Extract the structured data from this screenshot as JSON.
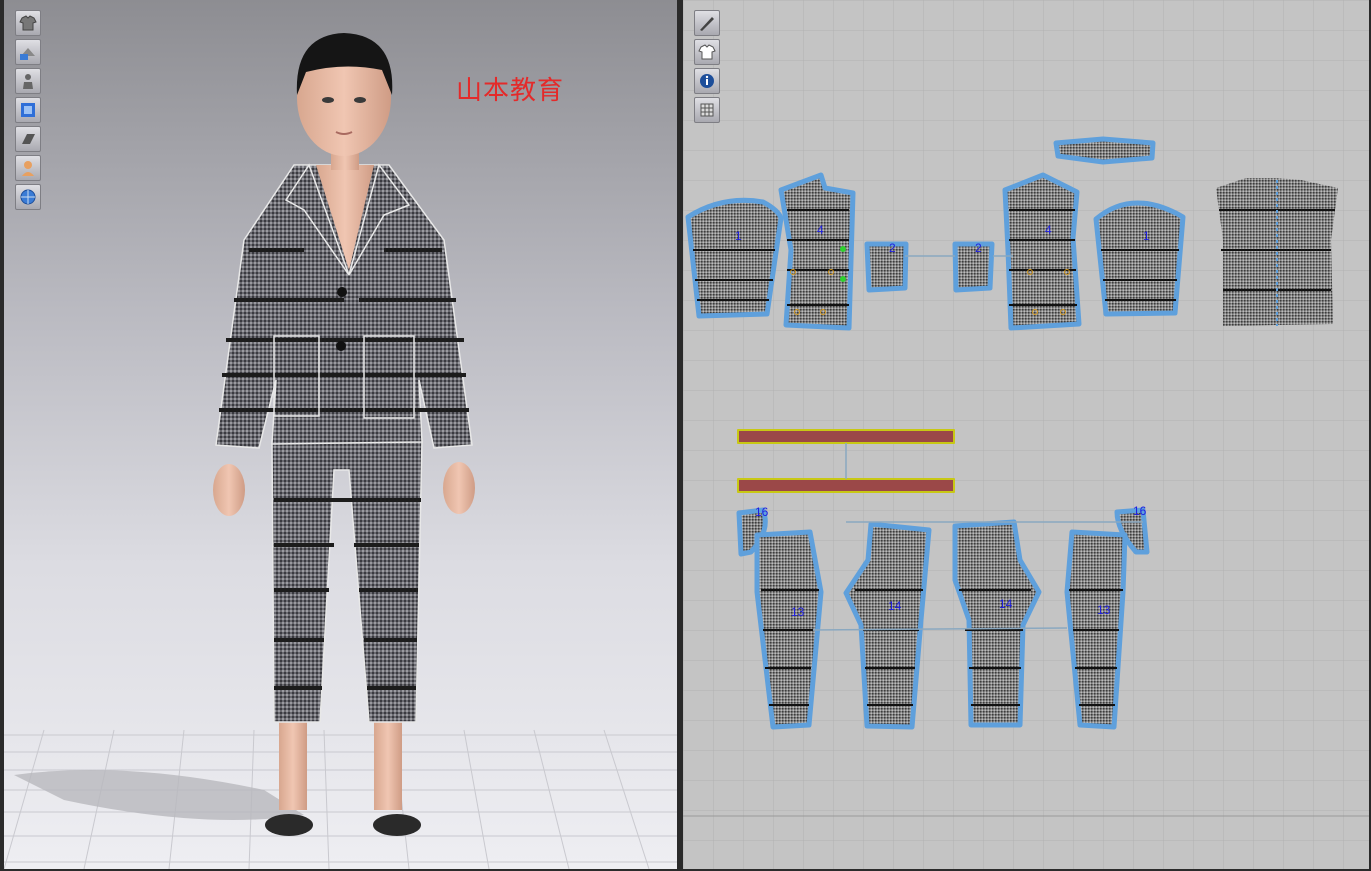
{
  "watermark": {
    "text": "山本教育"
  },
  "colors": {
    "accent_outline": "#5fa0dc",
    "label_blue": "#1e1ee0",
    "watermark_red": "#e42a2a",
    "grid_bg": "#c4c4c4"
  },
  "view3d": {
    "toolbar": [
      {
        "name": "show-garment-icon"
      },
      {
        "name": "show-garment-settings-icon"
      },
      {
        "name": "show-avatar-icon"
      },
      {
        "name": "avatar-display-icon"
      },
      {
        "name": "display-textures-icon"
      },
      {
        "name": "show-avatar-skin-icon"
      },
      {
        "name": "show-grid-globe-icon"
      }
    ]
  },
  "view2d": {
    "toolbar": [
      {
        "name": "show-pattern-tool-icon"
      },
      {
        "name": "show-garment-2d-icon"
      },
      {
        "name": "show-info-icon"
      },
      {
        "name": "show-texture-grid-icon"
      }
    ],
    "pattern_labels": {
      "sleeve_left": "1",
      "front_left": "4",
      "pocket_left": "2",
      "pocket_right": "2",
      "front_right": "4",
      "sleeve_right": "1",
      "pants_back_left": "13",
      "pants_front_left": "14",
      "pants_front_right": "14",
      "pants_back_right": "13",
      "pocket_bag_left": "16",
      "pocket_bag_right": "16"
    }
  }
}
